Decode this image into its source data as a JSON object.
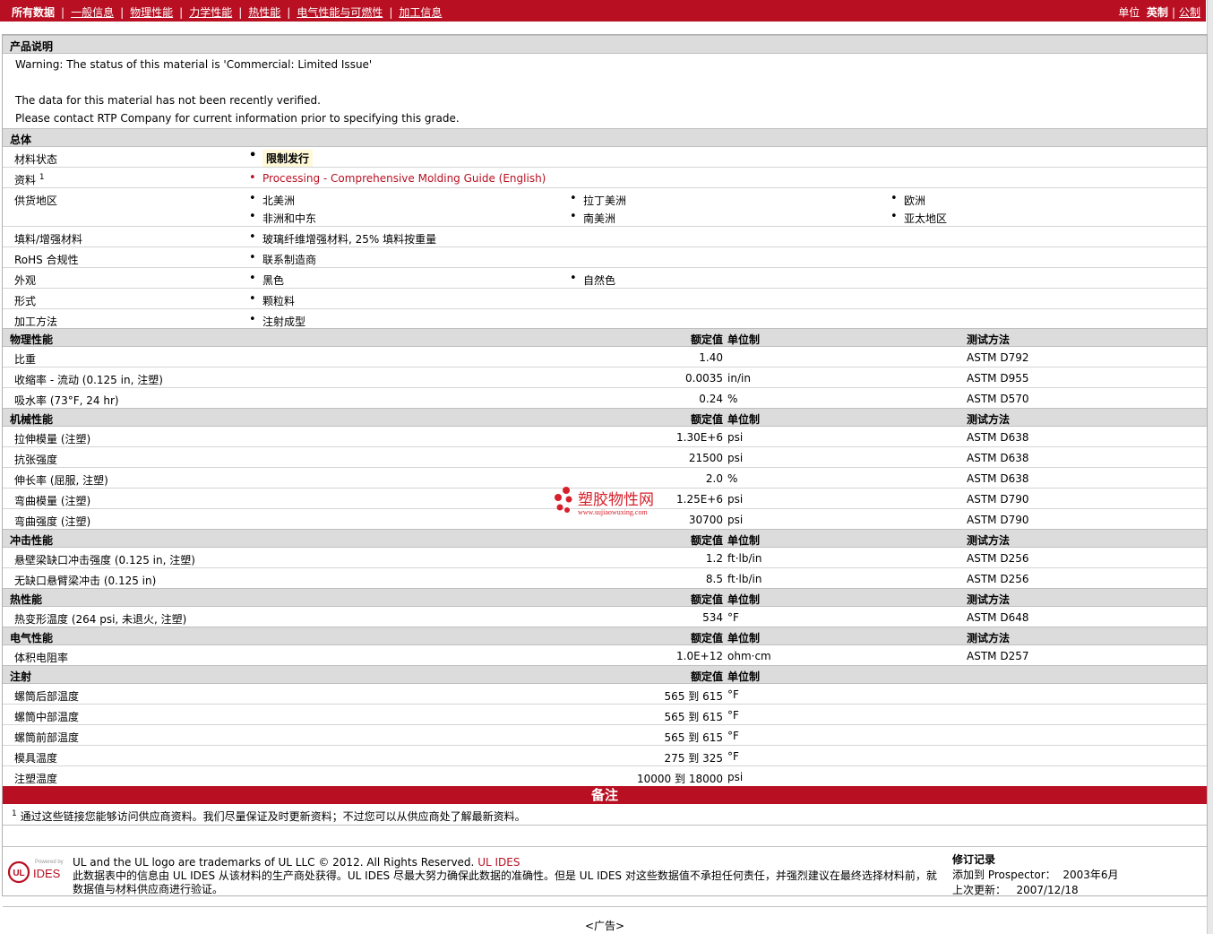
{
  "nav": {
    "items": [
      "所有数据",
      "一般信息",
      "物理性能",
      "力学性能",
      "热性能",
      "电气性能与可燃性",
      "加工信息"
    ],
    "units_label": "单位",
    "unit_english": "英制",
    "unit_metric": "公制"
  },
  "description": {
    "header": "产品说明",
    "line1": "Warning: The status of this material is 'Commercial: Limited Issue'",
    "line2": "The data for this material has not been recently verified.",
    "line3": "Please contact RTP Company for current information prior to specifying this grade."
  },
  "general": {
    "header": "总体",
    "status_label": "材料状态",
    "status_value": "限制发行",
    "source_label": "资料",
    "source_sup": "1",
    "source_link": "Processing - Comprehensive Molding Guide (English)",
    "regions_label": "供货地区",
    "regions": [
      "北美洲",
      "拉丁美洲",
      "欧洲",
      "非洲和中东",
      "南美洲",
      "亚太地区"
    ],
    "filler_label": "填料/增强材料",
    "filler_value": "玻璃纤维增强材料, 25% 填料按重量",
    "rohs_label": "RoHS 合规性",
    "rohs_value": "联系制造商",
    "appearance_label": "外观",
    "appearance": [
      "黑色",
      "自然色"
    ],
    "form_label": "形式",
    "form_value": "颗粒料",
    "process_label": "加工方法",
    "process_value": "注射成型"
  },
  "columns": {
    "value": "额定值",
    "unit": "单位制",
    "method": "测试方法"
  },
  "physical": {
    "header": "物理性能",
    "rows": [
      {
        "label": "比重",
        "value": "1.40",
        "unit": "",
        "method": "ASTM D792"
      },
      {
        "label": "收缩率  - 流动  (0.125 in, 注塑)",
        "value": "0.0035",
        "unit": "in/in",
        "method": "ASTM D955"
      },
      {
        "label": "吸水率  (73°F, 24 hr)",
        "value": "0.24",
        "unit": "%",
        "method": "ASTM D570"
      }
    ]
  },
  "mechanical": {
    "header": "机械性能",
    "rows": [
      {
        "label": "拉伸模量  (注塑)",
        "value": "1.30E+6",
        "unit": "psi",
        "method": "ASTM D638"
      },
      {
        "label": "抗张强度",
        "value": "21500",
        "unit": "psi",
        "method": "ASTM D638"
      },
      {
        "label": "伸长率  (屈服, 注塑)",
        "value": "2.0",
        "unit": "%",
        "method": "ASTM D638"
      },
      {
        "label": "弯曲模量  (注塑)",
        "value": "1.25E+6",
        "unit": "psi",
        "method": "ASTM D790"
      },
      {
        "label": "弯曲强度  (注塑)",
        "value": "30700",
        "unit": "psi",
        "method": "ASTM D790"
      }
    ]
  },
  "impact": {
    "header": "冲击性能",
    "rows": [
      {
        "label": "悬壁梁缺口冲击强度  (0.125 in, 注塑)",
        "value": "1.2",
        "unit": "ft·lb/in",
        "method": "ASTM D256"
      },
      {
        "label": "无缺口悬臂梁冲击  (0.125 in)",
        "value": "8.5",
        "unit": "ft·lb/in",
        "method": "ASTM D256"
      }
    ]
  },
  "thermal": {
    "header": "热性能",
    "rows": [
      {
        "label": "热变形温度  (264 psi, 未退火, 注塑)",
        "value": "534",
        "unit": "°F",
        "method": "ASTM D648"
      }
    ]
  },
  "electrical": {
    "header": "电气性能",
    "rows": [
      {
        "label": "体积电阻率",
        "value": "1.0E+12",
        "unit": "ohm·cm",
        "method": "ASTM D257"
      }
    ]
  },
  "injection": {
    "header": "注射",
    "rows": [
      {
        "label": "螺筒后部温度",
        "value": "565 到  615",
        "unit": "°F"
      },
      {
        "label": "螺筒中部温度",
        "value": "565 到  615",
        "unit": "°F"
      },
      {
        "label": "螺筒前部温度",
        "value": "565 到  615",
        "unit": "°F"
      },
      {
        "label": "模具温度",
        "value": "275 到  325",
        "unit": "°F"
      },
      {
        "label": "注塑温度",
        "value": "10000 到  18000",
        "unit": "psi"
      }
    ]
  },
  "notes": {
    "header": "备注",
    "footnote_sup": "1",
    "footnote": "通过这些链接您能够访问供应商资料。我们尽量保证及时更新资料；不过您可以从供应商处了解最新资料。"
  },
  "footer": {
    "logo_powered": "Powered by",
    "logo_ul": "UL",
    "logo_ides": "IDES",
    "trademark": "UL and the UL logo are trademarks of UL LLC © 2012. All Rights Reserved.",
    "trademark_link": "UL IDES",
    "disclaimer": "此数据表中的信息由  UL IDES 从该材料的生产商处获得。UL IDES 尽最大努力确保此数据的准确性。但是  UL IDES 对这些数据值不承担任何责任，并强烈建议在最终选择材料前，就数据值与材料供应商进行验证。",
    "revision_title": "修订记录",
    "added_label": "添加到  Prospector：",
    "added_value": "2003年6月",
    "updated_label": "上次更新：",
    "updated_value": "2007/12/18",
    "ad": "<广告>"
  },
  "watermark": {
    "text": "塑胶物性网",
    "url": "www.sujiaowuxing.com",
    "color": "#b80f22"
  }
}
